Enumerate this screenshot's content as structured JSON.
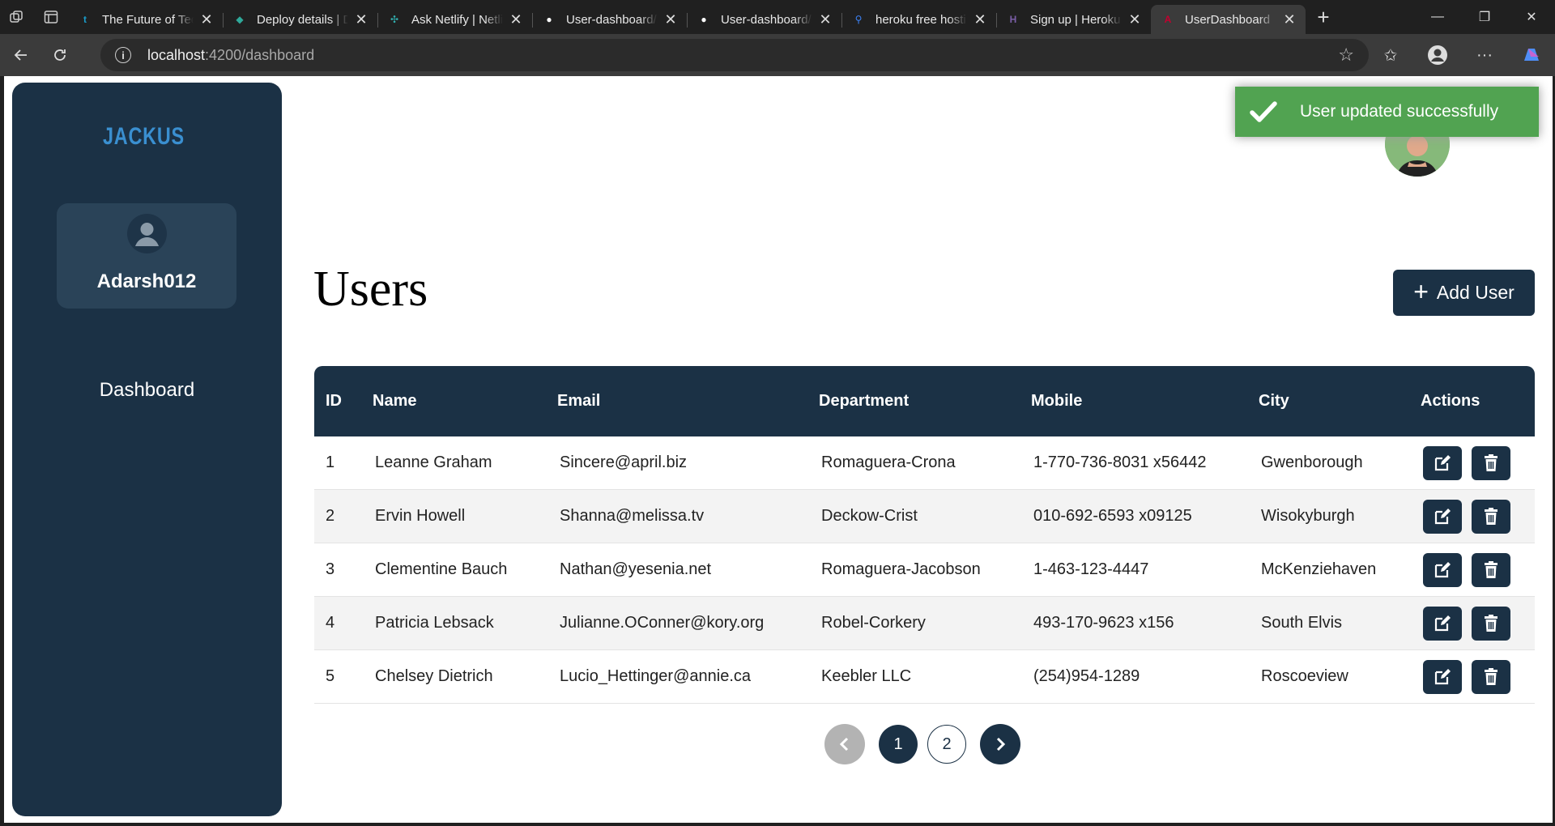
{
  "browser": {
    "tabs": [
      {
        "title": "The Future of Tech",
        "favicon_color": "#1a9cc9",
        "favicon_glyph": "t"
      },
      {
        "title": "Deploy details | Dep",
        "favicon_color": "#2fa99a",
        "favicon_glyph": "◆"
      },
      {
        "title": "Ask Netlify | Netlify",
        "favicon_color": "#31b0b0",
        "favicon_glyph": "✣"
      },
      {
        "title": "User-dashboard/src",
        "favicon_color": "#ffffff",
        "favicon_glyph": "●"
      },
      {
        "title": "User-dashboard/src",
        "favicon_color": "#ffffff",
        "favicon_glyph": "●"
      },
      {
        "title": "heroku free hosting",
        "favicon_color": "#3b82f6",
        "favicon_glyph": "⚲"
      },
      {
        "title": "Sign up | Heroku",
        "favicon_color": "#7b5ea7",
        "favicon_glyph": "H"
      },
      {
        "title": "UserDashboard",
        "favicon_color": "#c3002f",
        "favicon_glyph": "A"
      }
    ],
    "url_host": "localhost",
    "url_path": ":4200/dashboard"
  },
  "sidebar": {
    "logo_text": "JACKUS",
    "username": "Adarsh012",
    "nav_items": [
      {
        "label": "Dashboard"
      }
    ]
  },
  "toast": {
    "message": "User updated successfully",
    "color": "#51a351"
  },
  "main": {
    "title": "Users",
    "add_button_label": "Add User"
  },
  "table": {
    "headers": {
      "id": "ID",
      "name": "Name",
      "email": "Email",
      "department": "Department",
      "mobile": "Mobile",
      "city": "City",
      "actions": "Actions"
    },
    "rows": [
      {
        "id": "1",
        "name": "Leanne Graham",
        "email": "Sincere@april.biz",
        "department": "Romaguera-Crona",
        "mobile": "1-770-736-8031 x56442",
        "city": "Gwenborough"
      },
      {
        "id": "2",
        "name": "Ervin Howell",
        "email": "Shanna@melissa.tv",
        "department": "Deckow-Crist",
        "mobile": "010-692-6593 x09125",
        "city": "Wisokyburgh"
      },
      {
        "id": "3",
        "name": "Clementine Bauch",
        "email": "Nathan@yesenia.net",
        "department": "Romaguera-Jacobson",
        "mobile": "1-463-123-4447",
        "city": "McKenziehaven"
      },
      {
        "id": "4",
        "name": "Patricia Lebsack",
        "email": "Julianne.OConner@kory.org",
        "department": "Robel-Corkery",
        "mobile": "493-170-9623 x156",
        "city": "South Elvis"
      },
      {
        "id": "5",
        "name": "Chelsey Dietrich",
        "email": "Lucio_Hettinger@annie.ca",
        "department": "Keebler LLC",
        "mobile": "(254)954-1289",
        "city": "Roscoeview"
      }
    ]
  },
  "pagination": {
    "pages": [
      "1",
      "2"
    ],
    "current": "1"
  },
  "colors": {
    "primary": "#1b3145",
    "success": "#51a351",
    "sidebar_card": "#2a4358"
  }
}
